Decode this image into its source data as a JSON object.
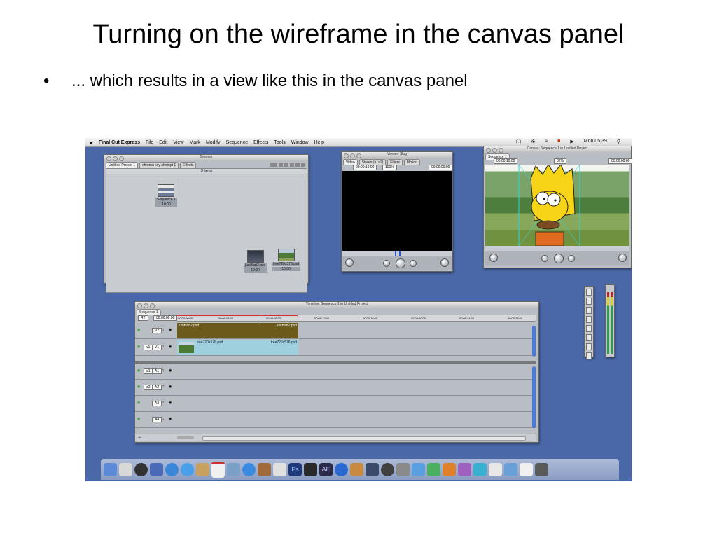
{
  "slide": {
    "title": "Turning on the wireframe in the canvas panel",
    "bullet_mark": "•",
    "bullet": "... which results in a view like this in the canvas panel"
  },
  "menubar": {
    "apple_icon": "apple-icon",
    "app_name": "Final Cut Express",
    "items": [
      "File",
      "Edit",
      "View",
      "Mark",
      "Modify",
      "Sequence",
      "Effects",
      "Tools",
      "Window",
      "Help"
    ],
    "clock": "Mon 05:39"
  },
  "browser": {
    "title": "Browser",
    "tabs": [
      "Untitled Project 1",
      "chroma key attempt 1",
      "Effects"
    ],
    "count": "3 items",
    "clips": [
      {
        "name": "Sequence 1",
        "duration": "10:00"
      },
      {
        "name": "justBart2.psd",
        "duration": "12:00"
      },
      {
        "name": "tree720x576.psd",
        "duration": "10:00"
      }
    ]
  },
  "viewer": {
    "title": "Viewer: Slug",
    "tabs": [
      "Video",
      "Stereo (a1a2)",
      "Filters",
      "Motion"
    ],
    "tc_left": "00:00:10:00",
    "zoom": "100%",
    "tc_right": "00:00:00:00"
  },
  "canvas": {
    "title": "Canvas: Sequence 1 in Untitled Project",
    "tab": "Sequence 1",
    "tc_left": "00:00:10:00",
    "zoom": "32%",
    "tc_right": "00:00:00:00"
  },
  "timeline": {
    "title": "Timeline: Sequence 1 in Untitled Project",
    "tab": "Sequence 1",
    "rt": "RT",
    "tc": "00:00:00:00",
    "ruler": [
      "00:00:00:00",
      "00:00:04:00",
      "00:00:08:00",
      "00:00:12:00",
      "00:00:16:00",
      "00:00:20:00",
      "00:00:24:00",
      "00:00:28:00"
    ],
    "video_tracks": [
      "V2",
      "V1"
    ],
    "audio_tracks": [
      "A1",
      "A2",
      "A3",
      "A4"
    ],
    "src_video": "v1",
    "src_audio": [
      "a1",
      "a2"
    ],
    "clips": {
      "v2_left": "justBart2.psd",
      "v2_right": "justBart2.psd",
      "v1_left": "tree720x576.psd",
      "v1_right": "tree720x576.psd"
    }
  },
  "colors": {
    "desktop": "#4a68a8",
    "v2_clip": "#6b5a1a",
    "v1_clip": "#9ed0de",
    "canvas_black": "#000000"
  }
}
